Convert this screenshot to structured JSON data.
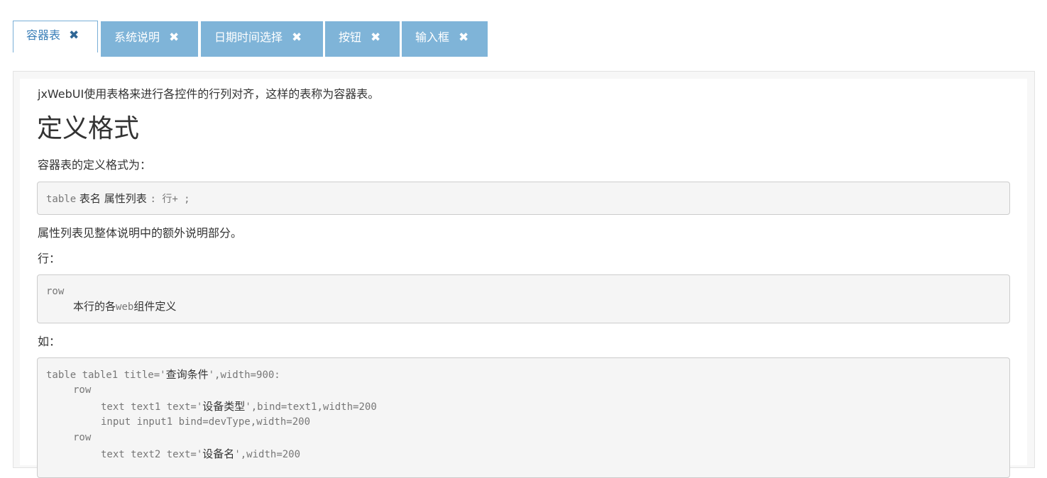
{
  "tabs": [
    {
      "label": "容器表",
      "active": true
    },
    {
      "label": "系统说明",
      "active": false
    },
    {
      "label": "日期时间选择",
      "active": false
    },
    {
      "label": "按钮",
      "active": false
    },
    {
      "label": "输入框",
      "active": false
    }
  ],
  "close_glyph": "✖",
  "doc": {
    "intro": "jxWebUI使用表格来进行各控件的行列对齐，这样的表称为容器表。",
    "heading": "定义格式",
    "def_label": "容器表的定义格式为：",
    "code1": {
      "kw": "table",
      "zh": " 表名 属性列表 ",
      "rest": ": 行+ ;"
    },
    "attr_note": "属性列表见整体说明中的额外说明部分。",
    "row_label": "行：",
    "code2": {
      "line1": "row",
      "line2_zh1": "本行的各",
      "line2_kw": "web",
      "line2_zh2": "组件定义"
    },
    "example_label": "如：",
    "code3": {
      "l1_a": "table table1 title='",
      "l1_zh": "查询条件",
      "l1_b": "',width=900:",
      "l2": "row",
      "l3_a": "text text1 text='",
      "l3_zh": "设备类型",
      "l3_b": "',bind=text1,width=200",
      "l4": "input input1 bind=devType,width=200",
      "l5": "row",
      "l6_a": "text text2 text='",
      "l6_zh": "设备名",
      "l6_b": "',width=200"
    }
  },
  "colors": {
    "tab_bg": "#7fb4d8",
    "tab_active_text": "#3b7fb8"
  }
}
